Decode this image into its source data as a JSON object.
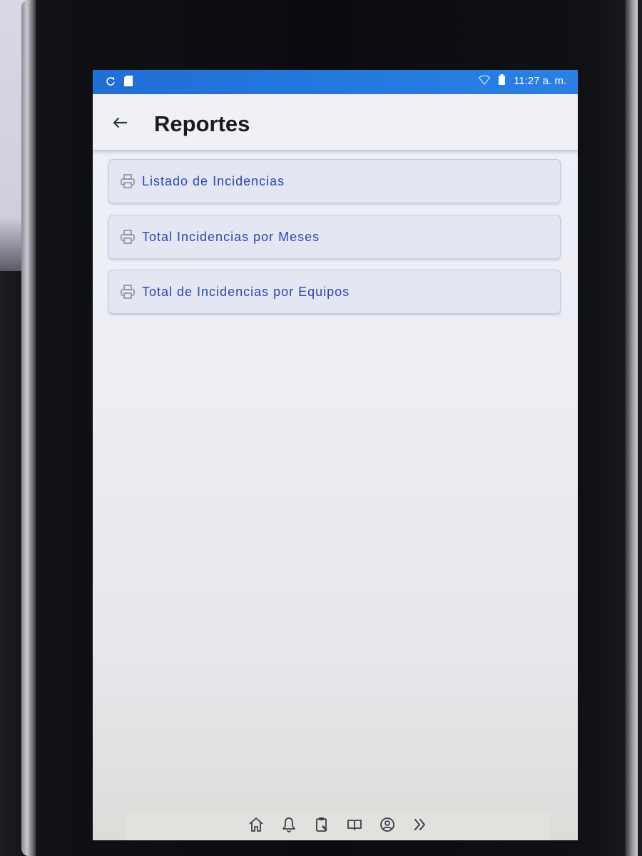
{
  "status_bar": {
    "time": "11:27 a. m.",
    "left_icons": [
      "sync-icon",
      "sd-card-icon"
    ],
    "right_icons": [
      "wifi-icon",
      "battery-icon"
    ]
  },
  "app_bar": {
    "back_icon": "arrow-left-icon",
    "title": "Reportes"
  },
  "reports": [
    {
      "icon": "printer-icon",
      "label": "Listado de Incidencias"
    },
    {
      "icon": "printer-icon",
      "label": "Total Incidencias por Meses"
    },
    {
      "icon": "printer-icon",
      "label": "Total de Incidencias por Equipos"
    }
  ],
  "bottom_nav": {
    "items": [
      "home-icon",
      "bell-icon",
      "clipboard-icon",
      "book-icon",
      "user-circle-icon",
      "chevrons-right-icon"
    ]
  },
  "colors": {
    "status_bar": "#2378de",
    "accent_text": "#2a45b8",
    "title_text": "#1a1b1f",
    "item_background": "#e4e6f2"
  }
}
